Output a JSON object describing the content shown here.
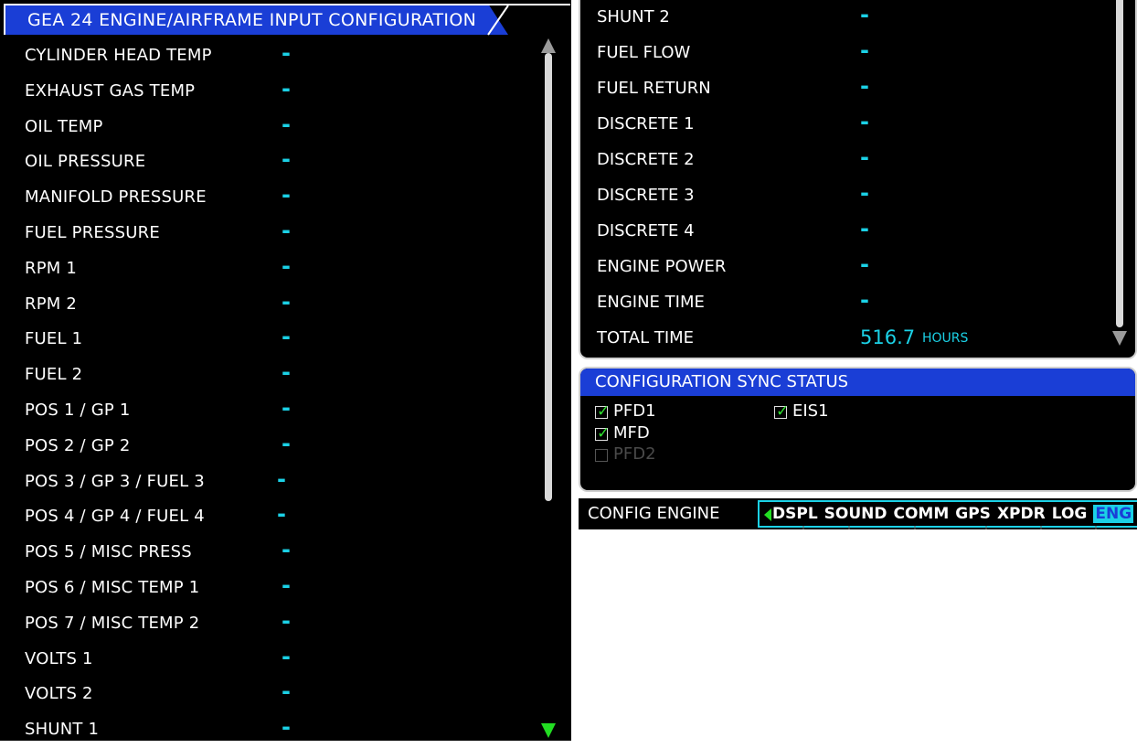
{
  "left": {
    "title": "GEA 24 ENGINE/AIRFRAME INPUT CONFIGURATION",
    "rows": [
      {
        "label": "CYLINDER HEAD TEMP",
        "value": "-"
      },
      {
        "label": "EXHAUST GAS TEMP",
        "value": "-"
      },
      {
        "label": "OIL TEMP",
        "value": "-"
      },
      {
        "label": "OIL PRESSURE",
        "value": "-"
      },
      {
        "label": "MANIFOLD PRESSURE",
        "value": "-"
      },
      {
        "label": "FUEL PRESSURE",
        "value": "-"
      },
      {
        "label": "RPM 1",
        "value": "-"
      },
      {
        "label": "RPM 2",
        "value": "-"
      },
      {
        "label": "FUEL 1",
        "value": "-"
      },
      {
        "label": "FUEL 2",
        "value": "-"
      },
      {
        "label": "POS 1 / GP 1",
        "value": "-"
      },
      {
        "label": "POS 2 / GP 2",
        "value": "-"
      },
      {
        "label": "POS 3 / GP 3 / FUEL 3",
        "value": "-"
      },
      {
        "label": "POS 4 / GP 4 / FUEL 4",
        "value": "-"
      },
      {
        "label": "POS 5 / MISC PRESS",
        "value": "-"
      },
      {
        "label": "POS 6 / MISC TEMP 1",
        "value": "-"
      },
      {
        "label": "POS 7 / MISC TEMP 2",
        "value": "-"
      },
      {
        "label": "VOLTS 1",
        "value": "-"
      },
      {
        "label": "VOLTS 2",
        "value": "-"
      },
      {
        "label": "SHUNT 1",
        "value": "-"
      }
    ]
  },
  "right": {
    "rows": [
      {
        "label": "SHUNT 2",
        "value": "-"
      },
      {
        "label": "FUEL FLOW",
        "value": "-"
      },
      {
        "label": "FUEL RETURN",
        "value": "-"
      },
      {
        "label": "DISCRETE 1",
        "value": "-"
      },
      {
        "label": "DISCRETE 2",
        "value": "-"
      },
      {
        "label": "DISCRETE 3",
        "value": "-"
      },
      {
        "label": "DISCRETE 4",
        "value": "-"
      },
      {
        "label": "ENGINE POWER",
        "value": "-"
      },
      {
        "label": "ENGINE TIME",
        "value": "-"
      }
    ],
    "total": {
      "label": "TOTAL TIME",
      "value": "516.7",
      "unit": "HOURS"
    }
  },
  "sync": {
    "title": "CONFIGURATION SYNC STATUS",
    "items": [
      {
        "label": "PFD1",
        "checked": true
      },
      {
        "label": "EIS1",
        "checked": true
      },
      {
        "label": "MFD",
        "checked": true
      },
      {
        "label": "PFD2",
        "checked": false
      }
    ]
  },
  "softbar": {
    "page_name": "CONFIG ENGINE",
    "tabs": [
      "DSPL",
      "SOUND",
      "COMM",
      "GPS",
      "XPDR",
      "LOG",
      "ENG"
    ],
    "active_tab": "ENG"
  },
  "colors": {
    "header_blue": "#1a3ed6",
    "value_cyan": "#1bd1e6",
    "check_green": "#2fe02f"
  },
  "icons": {
    "scroll_up": "triangle-up-icon",
    "scroll_down": "triangle-down-icon",
    "tab_left": "triangle-left-icon",
    "checkbox": "checkbox-icon"
  }
}
